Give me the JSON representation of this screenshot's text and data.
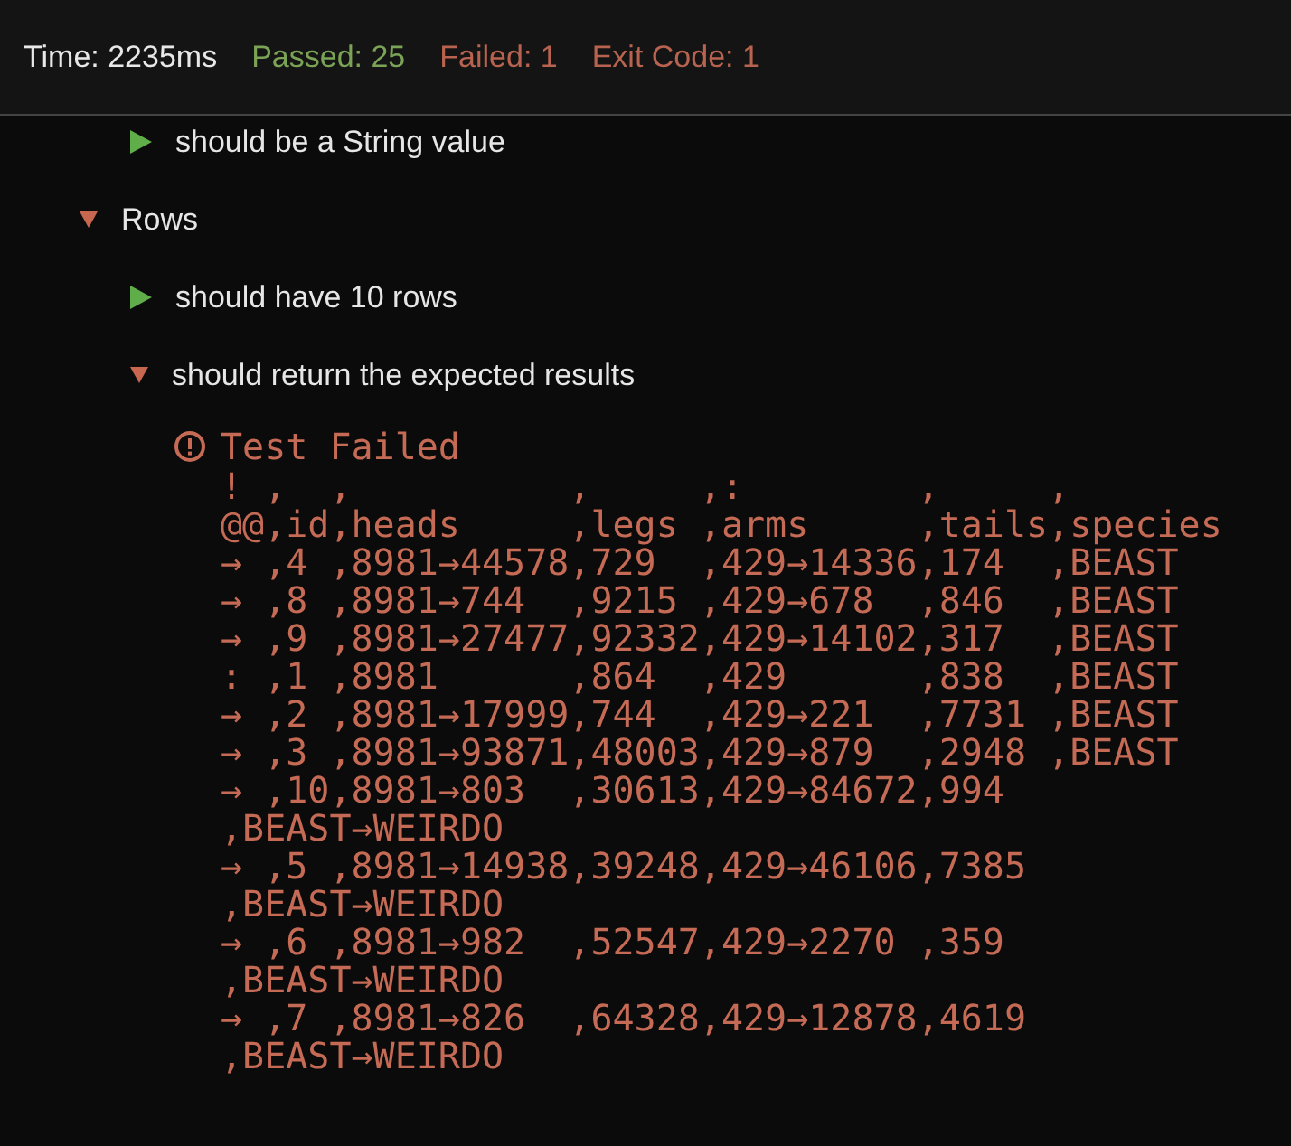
{
  "status_bar": [
    {
      "kind": "time",
      "text": "Time: 2235ms"
    },
    {
      "kind": "passed",
      "text": "Passed: 25"
    },
    {
      "kind": "failed",
      "text": "Failed: 1"
    },
    {
      "kind": "exit",
      "text": "Exit Code: 1"
    }
  ],
  "tree": [
    {
      "children": [
        {
          "label": "should be a String value",
          "passed": true,
          "expanded": false
        }
      ]
    },
    {
      "label": "Rows",
      "passed": false,
      "expanded": true,
      "children": [
        {
          "label": "should have 10 rows",
          "passed": true,
          "expanded": false
        },
        {
          "label": "should return the expected results",
          "passed": false,
          "expanded": true,
          "error": {
            "title": "Test Failed",
            "lines": [
              "! ,  ,          ,     ,:        ,     ,",
              "@@,id,heads     ,legs ,arms     ,tails,species",
              "→ ,4 ,8981→44578,729  ,429→14336,174  ,BEAST",
              "→ ,8 ,8981→744  ,9215 ,429→678  ,846  ,BEAST",
              "→ ,9 ,8981→27477,92332,429→14102,317  ,BEAST",
              ": ,1 ,8981      ,864  ,429      ,838  ,BEAST",
              "→ ,2 ,8981→17999,744  ,429→221  ,7731 ,BEAST",
              "→ ,3 ,8981→93871,48003,429→879  ,2948 ,BEAST",
              "→ ,10,8981→803  ,30613,429→84672,994  ,BEAST→WEIRDO",
              "→ ,5 ,8981→14938,39248,429→46106,7385 ,BEAST→WEIRDO",
              "→ ,6 ,8981→982  ,52547,429→2270 ,359  ,BEAST→WEIRDO",
              "→ ,7 ,8981→826  ,64328,429→12878,4619 ,BEAST→WEIRDO"
            ]
          }
        }
      ]
    }
  ]
}
